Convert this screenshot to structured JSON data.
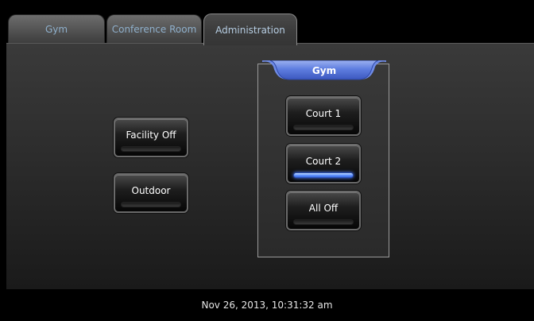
{
  "tabs": [
    {
      "label": "Gym",
      "active": false
    },
    {
      "label": "Conference Room",
      "active": false
    },
    {
      "label": "Administration",
      "active": true
    }
  ],
  "facility_controls": {
    "facility_off": {
      "label": "Facility Off",
      "on": false
    },
    "outdoor": {
      "label": "Outdoor",
      "on": false
    }
  },
  "gym_group": {
    "title": "Gym",
    "buttons": [
      {
        "label": "Court 1",
        "on": false
      },
      {
        "label": "Court 2",
        "on": true
      },
      {
        "label": "All Off",
        "on": false
      }
    ]
  },
  "status": {
    "timestamp": "Nov 26, 2013, 10:31:32 am"
  },
  "colors": {
    "indicator_on": "#4c7dff",
    "group_header": "#5a78d8",
    "tab_text": "#8fb0cc"
  }
}
